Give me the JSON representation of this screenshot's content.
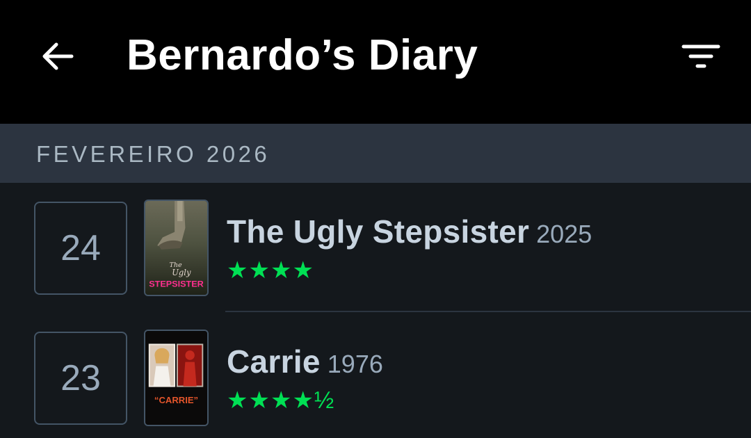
{
  "header": {
    "title": "Bernardo’s Diary",
    "back_icon": "arrow-left-icon",
    "filter_icon": "filter-icon"
  },
  "section": {
    "label": "FEVEREIRO 2026"
  },
  "entries": [
    {
      "day": "24",
      "title": "The Ugly Stepsister",
      "year": "2025",
      "rating": 4,
      "rating_display": "★★★★",
      "poster_text": "STEPSISTER"
    },
    {
      "day": "23",
      "title": "Carrie",
      "year": "1976",
      "rating": 4.5,
      "rating_display": "★★★★½",
      "poster_text": "“CARRIE”"
    }
  ],
  "colors": {
    "header_bg": "#000000",
    "section_bg": "#2c3440",
    "page_bg": "#14181c",
    "star_green": "#00e054"
  }
}
